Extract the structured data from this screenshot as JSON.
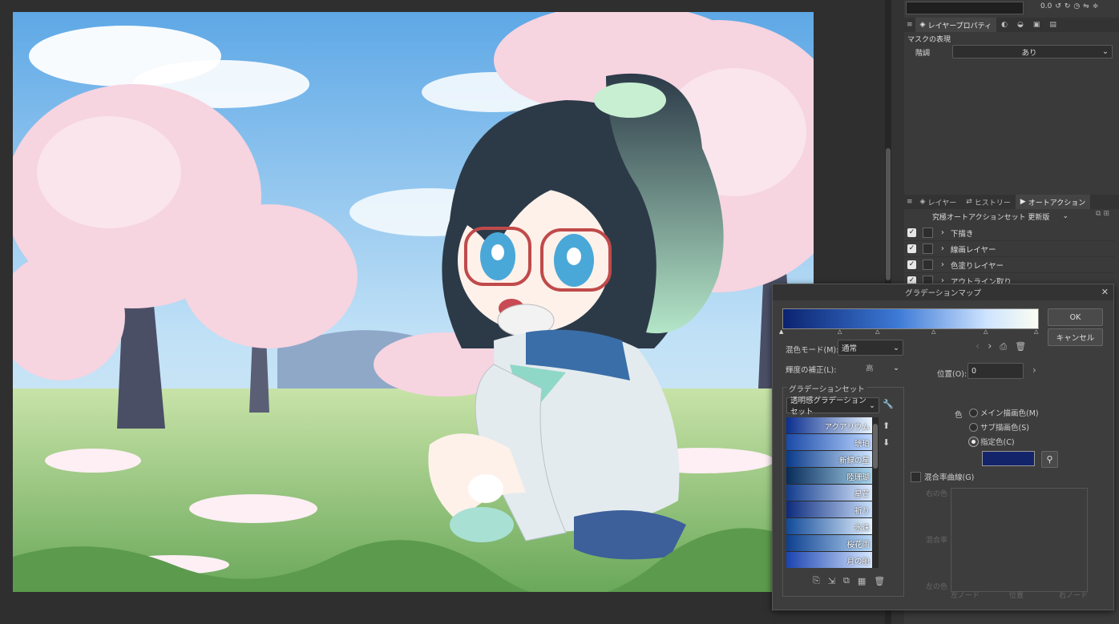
{
  "right_panel": {
    "top_readout": "0.0",
    "layer_props_tab": "レイヤープロパティ",
    "mask_section": "マスクの表現",
    "gradation_label": "階調",
    "gradation_value": "あり",
    "tabs": [
      "レイヤー",
      "ヒストリー",
      "オートアクション"
    ],
    "action_set": "究極オートアクションセット 更新版",
    "actions": [
      {
        "label": "下描き",
        "checked": true
      },
      {
        "label": "線画レイヤー",
        "checked": true
      },
      {
        "label": "色塗りレイヤー",
        "checked": true
      },
      {
        "label": "アウトライン取り",
        "checked": true
      }
    ]
  },
  "dialog": {
    "title": "グラデーションマップ",
    "close": "✕",
    "ok": "OK",
    "cancel": "キャンセル",
    "blend_mode_label": "混色モード(M):",
    "blend_mode_value": "通常",
    "luminance_label": "輝度の補正(L):",
    "luminance_value": "高",
    "position_label": "位置(O):",
    "position_value": "0",
    "gradient_set_title": "グラデーションセット",
    "gradient_set_value": "透明感グラデーションセット",
    "gradients": [
      {
        "name": "アクアリウム",
        "from": "#0c2f8f",
        "to": "#e8f4ff"
      },
      {
        "name": "琥珀",
        "from": "#1a4aa8",
        "to": "#bcd6ff"
      },
      {
        "name": "新緑の星",
        "from": "#0a3a8a",
        "to": "#cfe6ff"
      },
      {
        "name": "陸珊瑚",
        "from": "#082c5a",
        "to": "#a8d4ee"
      },
      {
        "name": "星芒",
        "from": "#123c8c",
        "to": "#dbe9ff"
      },
      {
        "name": "祈り",
        "from": "#0e2b7c",
        "to": "#c7defa"
      },
      {
        "name": "氷沫",
        "from": "#114a98",
        "to": "#e4f2ff"
      },
      {
        "name": "桜花雨",
        "from": "#0d3f8e",
        "to": "#b7d7f5"
      },
      {
        "name": "月の船",
        "from": "#1c44b0",
        "to": "#d6e7ff"
      }
    ],
    "color_label": "色",
    "color_options": [
      "メイン描画色(M)",
      "サブ描画色(S)",
      "指定色(C)"
    ],
    "selected_color_index": 2,
    "selected_color": "#13246b",
    "blend_curve_label": "混合率曲線(G)",
    "graph_right_color": "右の色",
    "graph_blend_rate": "混合率",
    "graph_left_color": "左の色",
    "graph_left_node": "左ノード",
    "graph_position": "位置",
    "graph_right_node": "右ノード",
    "main_gradient_from": "#0b2370",
    "main_gradient_to": "#fbfdf2"
  }
}
